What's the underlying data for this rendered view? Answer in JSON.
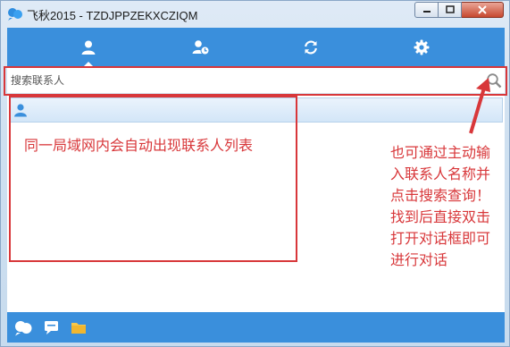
{
  "window": {
    "title": "飞秋2015 - TZDJPPZEKXCZIQM",
    "brand_color": "#3a8fdc",
    "controls": [
      "minimize",
      "maximize",
      "close"
    ]
  },
  "tabs": [
    {
      "icon": "contacts-icon",
      "active": true
    },
    {
      "icon": "recent-contacts-icon",
      "active": false
    },
    {
      "icon": "refresh-icon",
      "active": false
    },
    {
      "icon": "settings-gear-icon",
      "active": false
    }
  ],
  "search": {
    "placeholder": "搜索联系人",
    "value": ""
  },
  "contacts": {
    "group_icon": "user-group-icon",
    "items": []
  },
  "bottom_toolbar": [
    "app-menu-icon",
    "message-icon",
    "folder-icon"
  ],
  "annotations": {
    "list_note": "同一局域网内会自动出现联系人列表",
    "search_note": [
      "也可通过主动输",
      "入联系人名称并",
      "点击搜索查询！",
      "找到后直接双击",
      "打开对话框即可",
      "进行对话"
    ],
    "color": "#d8373a"
  }
}
